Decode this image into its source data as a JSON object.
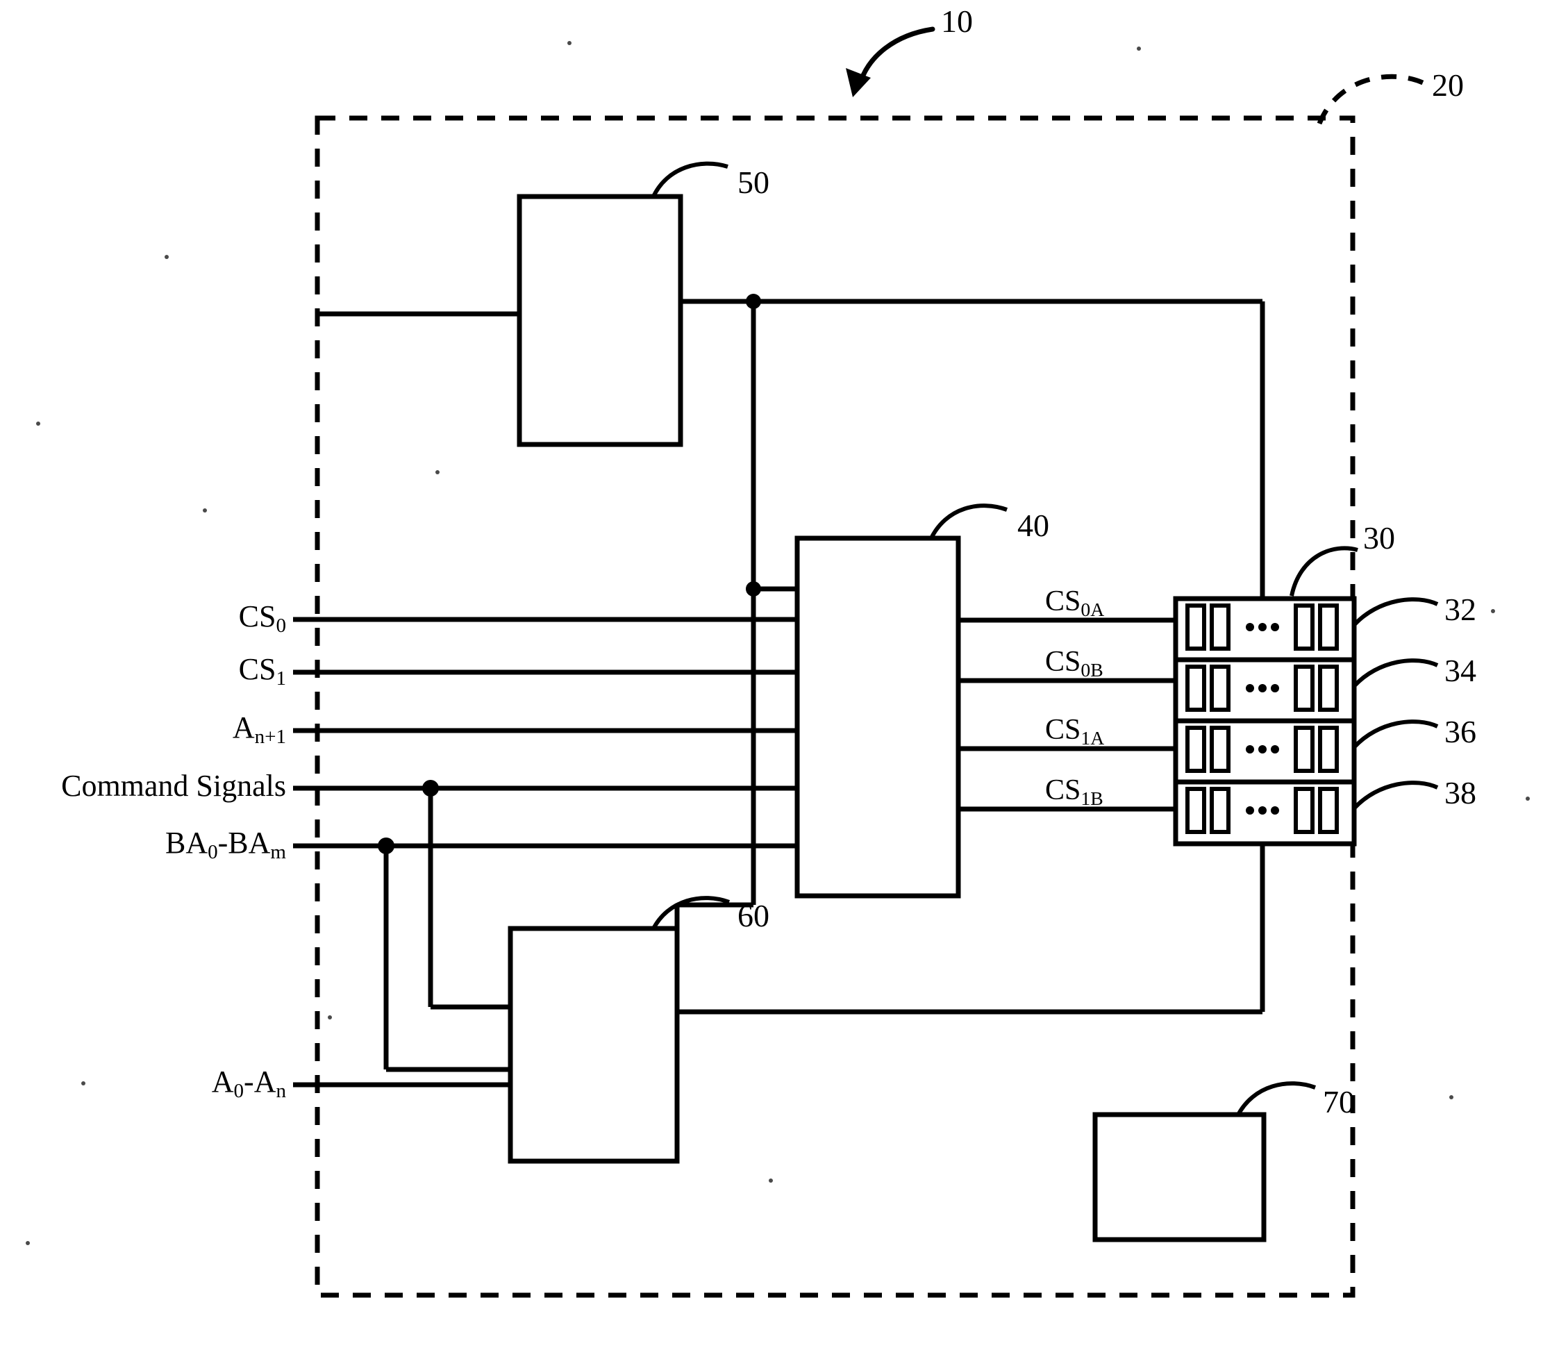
{
  "figure": {
    "kind": "patent-block-diagram",
    "system_numeral": "10",
    "boundary_numeral": "20"
  },
  "input_signals": [
    {
      "id": "cs0",
      "base": "CS",
      "sub": "0",
      "label": "CS0"
    },
    {
      "id": "cs1",
      "base": "CS",
      "sub": "1",
      "label": "CS1"
    },
    {
      "id": "an1",
      "base": "A",
      "sub": "n+1",
      "label": "An+1"
    },
    {
      "id": "cmd",
      "base": "Command Signals",
      "sub": "",
      "label": "Command Signals"
    },
    {
      "id": "ba",
      "base": "BA",
      "sub": "0",
      "mid": "-BA",
      "sub2": "m",
      "label": "BA0-BAm"
    },
    {
      "id": "addr",
      "base": "A",
      "sub": "0",
      "mid": "-A",
      "sub2": "n",
      "label": "A0-An"
    }
  ],
  "output_signals": [
    {
      "id": "cs0a",
      "base": "CS",
      "sub": "0A",
      "label": "CS0A"
    },
    {
      "id": "cs0b",
      "base": "CS",
      "sub": "0B",
      "label": "CS0B"
    },
    {
      "id": "cs1a",
      "base": "CS",
      "sub": "1A",
      "label": "CS1A"
    },
    {
      "id": "cs1b",
      "base": "CS",
      "sub": "1B",
      "label": "CS1B"
    }
  ],
  "blocks": [
    {
      "id": "b50",
      "numeral": "50"
    },
    {
      "id": "b40",
      "numeral": "40"
    },
    {
      "id": "b60",
      "numeral": "60"
    },
    {
      "id": "b70",
      "numeral": "70"
    },
    {
      "id": "b30",
      "numeral": "30"
    }
  ],
  "memory_ranks": [
    {
      "id": "rank32",
      "numeral": "32",
      "chips": 4,
      "ellipsis": "• • •"
    },
    {
      "id": "rank34",
      "numeral": "34",
      "chips": 4,
      "ellipsis": "• • •"
    },
    {
      "id": "rank36",
      "numeral": "36",
      "chips": 4,
      "ellipsis": "• • •"
    },
    {
      "id": "rank38",
      "numeral": "38",
      "chips": 4,
      "ellipsis": "• • •"
    }
  ],
  "colors": {
    "ink": "#000000",
    "paper": "#ffffff"
  }
}
